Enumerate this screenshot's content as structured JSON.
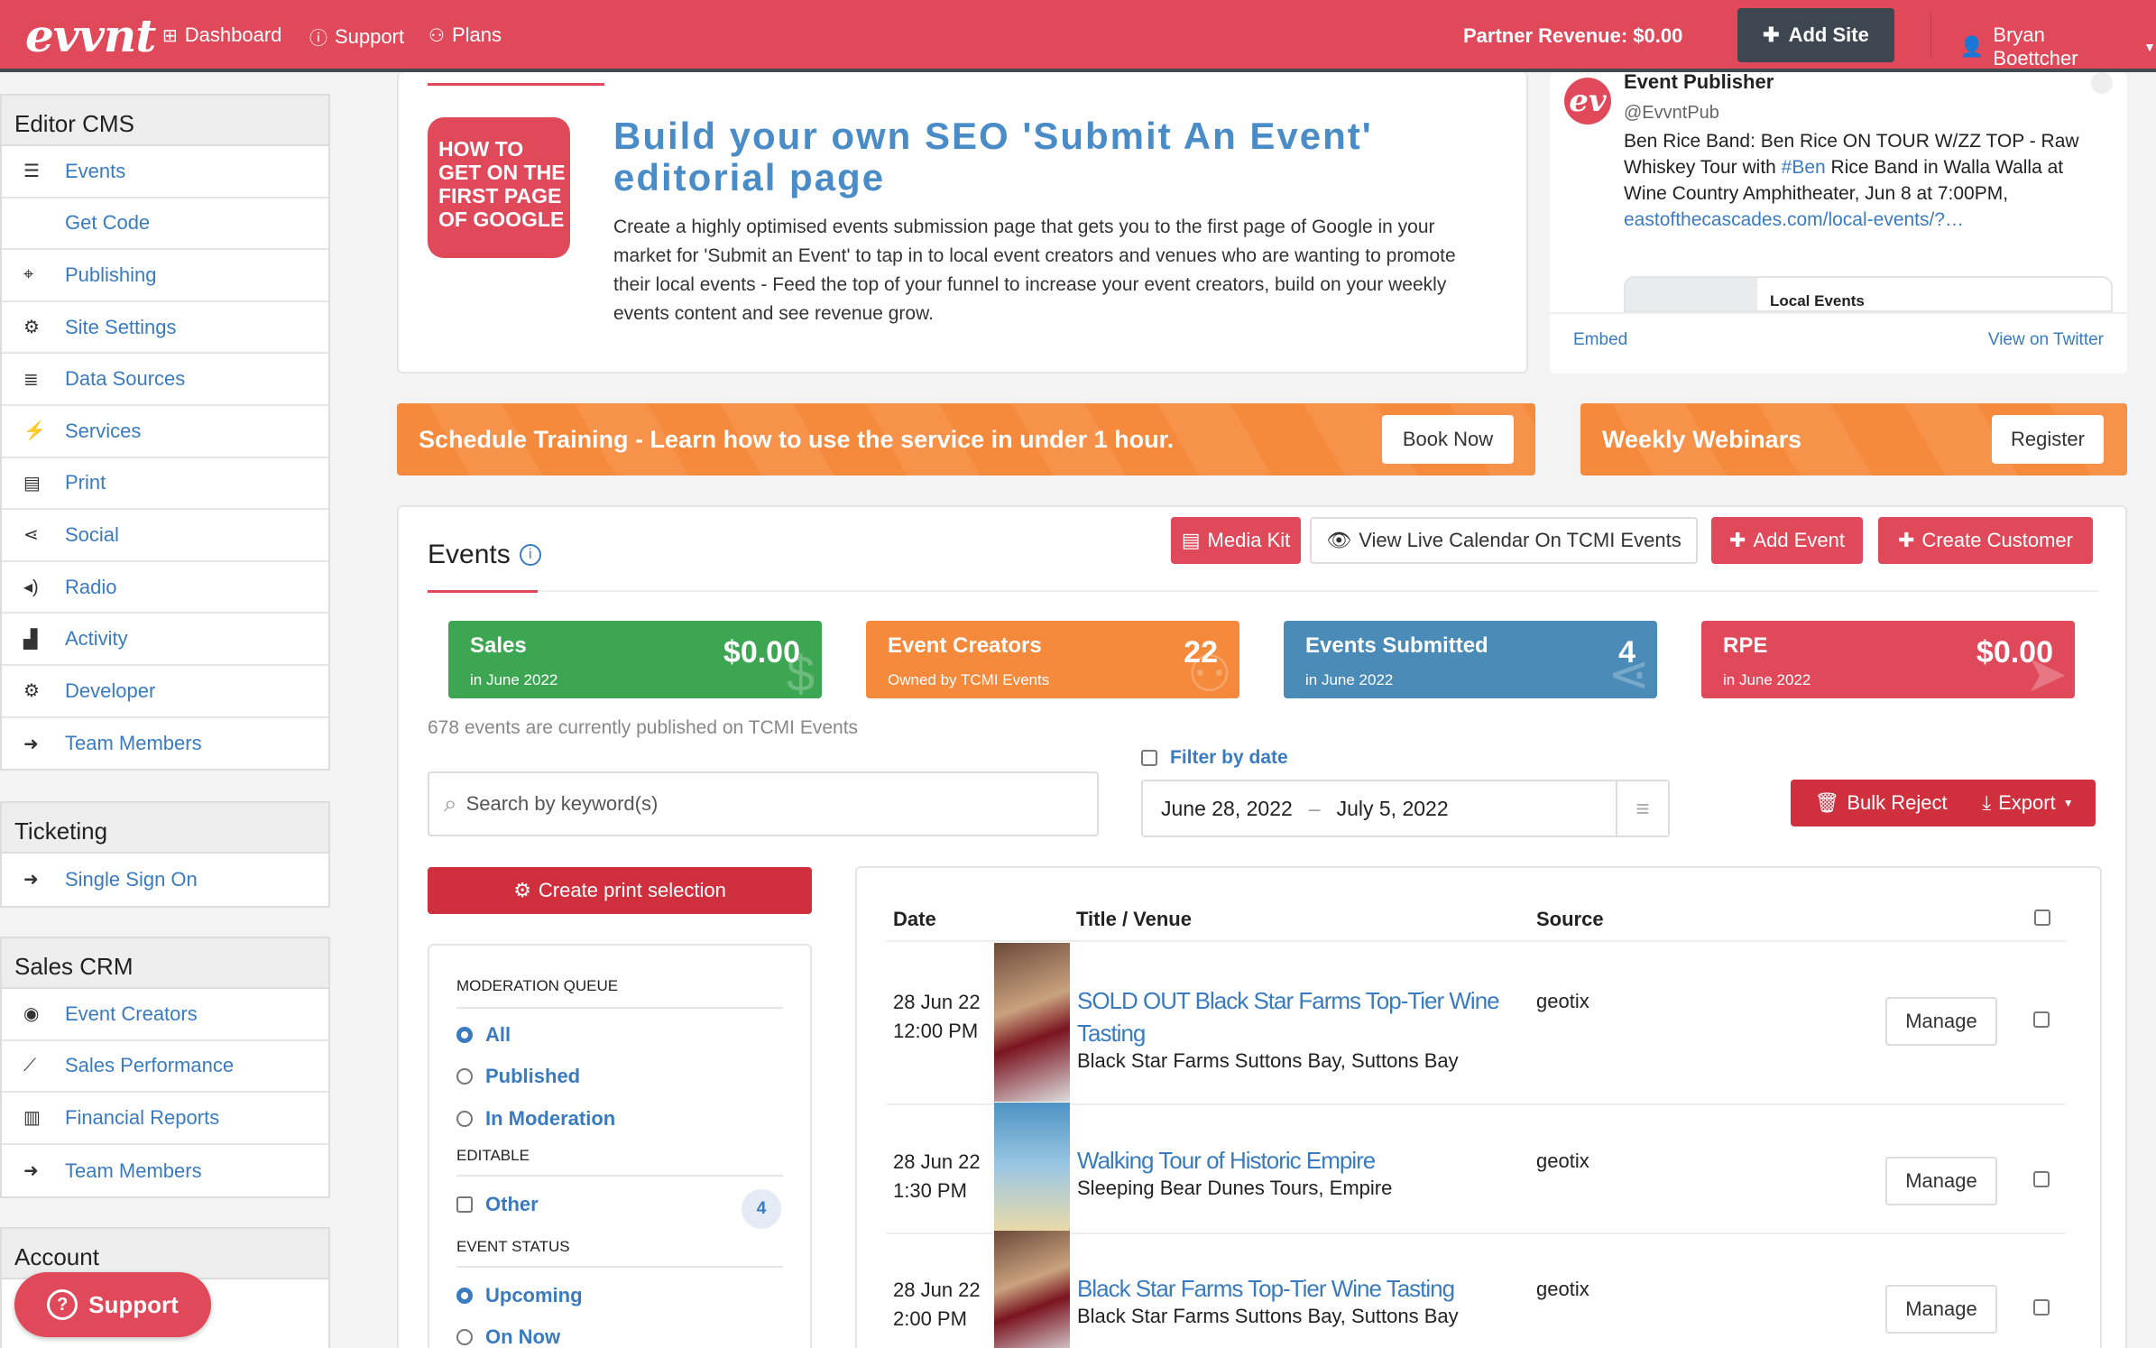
{
  "topbar": {
    "logo": "evvnt",
    "nav": [
      {
        "label": "Dashboard",
        "icon": "sitemap-icon"
      },
      {
        "label": "Support",
        "icon": "info-icon"
      },
      {
        "label": "Plans",
        "icon": "users-icon"
      }
    ],
    "revenue": "Partner Revenue: $0.00",
    "add_site": "Add Site",
    "user": "Bryan Boettcher"
  },
  "sidebar": {
    "editor": {
      "title": "Editor CMS",
      "items": [
        {
          "label": "Events",
          "icon": "list-icon"
        },
        {
          "label": "Get Code",
          "icon": "code-icon"
        },
        {
          "label": "Publishing",
          "icon": "crosshair-icon"
        },
        {
          "label": "Site Settings",
          "icon": "cogs-icon"
        },
        {
          "label": "Data Sources",
          "icon": "database-icon"
        },
        {
          "label": "Services",
          "icon": "plug-icon"
        },
        {
          "label": "Print",
          "icon": "newspaper-icon"
        },
        {
          "label": "Social",
          "icon": "share-icon"
        },
        {
          "label": "Radio",
          "icon": "volume-icon"
        },
        {
          "label": "Activity",
          "icon": "area-chart-icon"
        },
        {
          "label": "Developer",
          "icon": "gear-icon"
        },
        {
          "label": "Team Members",
          "icon": "sign-in-icon"
        }
      ]
    },
    "ticketing": {
      "title": "Ticketing",
      "items": [
        {
          "label": "Single Sign On",
          "icon": "sign-in-icon"
        }
      ]
    },
    "crm": {
      "title": "Sales CRM",
      "items": [
        {
          "label": "Event Creators",
          "icon": "user-circle-icon"
        },
        {
          "label": "Sales Performance",
          "icon": "line-chart-icon"
        },
        {
          "label": "Financial Reports",
          "icon": "bar-chart-icon"
        },
        {
          "label": "Team Members",
          "icon": "sign-in-icon"
        }
      ]
    },
    "account": {
      "title": "Account"
    },
    "support_btn": "Support"
  },
  "seo": {
    "badge": "HOW TO GET ON THE FIRST PAGE OF GOOGLE",
    "title": "Build your own SEO 'Submit An Event' editorial page",
    "text": "Create a highly optimised events submission page that gets you to the first page of Google in your market for 'Submit an Event' to tap in to local event creators and venues who are wanting to promote their local events - Feed the top of your funnel to increase your event creators, build on your weekly events content and see revenue grow."
  },
  "tweet": {
    "name": "Event Publisher",
    "handle": "@EvvntPub",
    "text_a": "Ben Rice Band: Ben Rice ON TOUR W/ZZ TOP - Raw Whiskey Tour with ",
    "hashtag": "#Ben",
    "text_b": " Rice Band in Walla Walla at Wine Country Amphitheater, Jun 8 at 7:00PM,",
    "link": "eastofthecascades.com/local-events/?…",
    "card_label": "Local Events",
    "embed": "Embed",
    "view": "View on Twitter"
  },
  "banners": {
    "training": "Schedule Training - Learn how to use the service in under 1 hour.",
    "book": "Book Now",
    "webinars": "Weekly Webinars",
    "register": "Register"
  },
  "events": {
    "title": "Events",
    "media_kit": "Media Kit",
    "view_live": "View Live Calendar On TCMI Events",
    "add_event": "Add Event",
    "create_customer": "Create Customer",
    "stats": [
      {
        "title": "Sales",
        "sub": "in June 2022",
        "value": "$0.00",
        "color": "#3ca653",
        "icon": "dollar-icon"
      },
      {
        "title": "Event Creators",
        "sub": "Owned by TCMI Events",
        "value": "22",
        "color": "#f58a3c",
        "icon": "users-icon"
      },
      {
        "title": "Events Submitted",
        "sub": "in June 2022",
        "value": "4",
        "color": "#4a8bb8",
        "icon": "share-icon"
      },
      {
        "title": "RPE",
        "sub": "in June 2022",
        "value": "$0.00",
        "color": "#e0495a",
        "icon": "arrow-icon"
      }
    ],
    "published_note": "678 events are currently published on TCMI Events",
    "filter_by_date": "Filter by date",
    "search_placeholder": "Search by keyword(s)",
    "date_from": "June 28, 2022",
    "date_sep": "–",
    "date_to": "July 5, 2022",
    "bulk_reject": "Bulk Reject",
    "export": "Export",
    "print_selection": "Create print selection",
    "moderation": {
      "heading": "MODERATION QUEUE",
      "all": "All",
      "published": "Published",
      "in_moderation": "In Moderation",
      "editable": "EDITABLE",
      "other": "Other",
      "other_count": "4",
      "status_heading": "EVENT STATUS",
      "upcoming": "Upcoming",
      "on_now": "On Now"
    },
    "table": {
      "headers": {
        "date": "Date",
        "title": "Title / Venue",
        "source": "Source"
      },
      "rows": [
        {
          "date": "28 Jun 22",
          "time": "12:00 PM",
          "title": "SOLD OUT Black Star Farms Top-Tier Wine Tasting",
          "venue": "Black Star Farms Suttons Bay, Suttons Bay",
          "source": "geotix",
          "action": "Manage"
        },
        {
          "date": "28 Jun 22",
          "time": "1:30 PM",
          "title": "Walking Tour of Historic Empire",
          "venue": "Sleeping Bear Dunes Tours, Empire",
          "source": "geotix",
          "action": "Manage"
        },
        {
          "date": "28 Jun 22",
          "time": "2:00 PM",
          "title": "Black Star Farms Top-Tier Wine Tasting",
          "venue": "Black Star Farms Suttons Bay, Suttons Bay",
          "source": "geotix",
          "action": "Manage"
        }
      ]
    }
  }
}
